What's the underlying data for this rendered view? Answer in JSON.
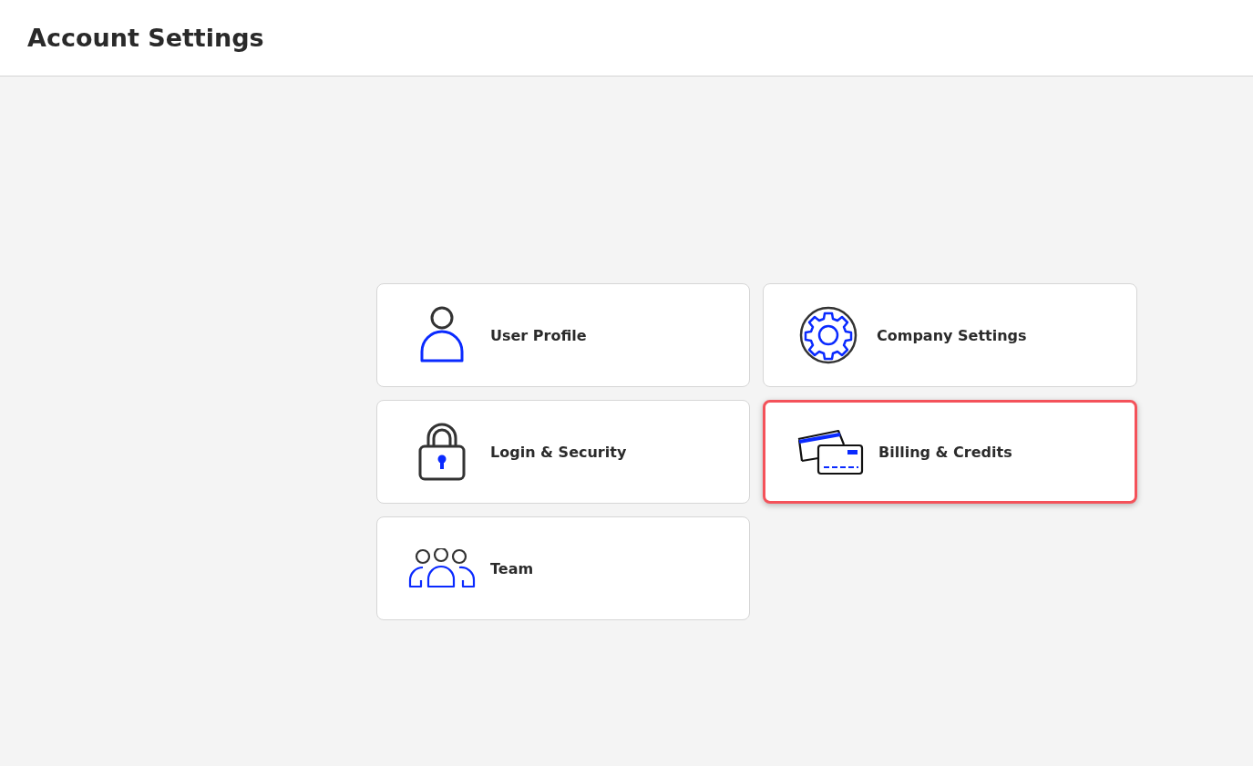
{
  "header": {
    "title": "Account Settings"
  },
  "cards": [
    {
      "kind": "user",
      "label": "User Profile",
      "highlighted": false
    },
    {
      "kind": "gear",
      "label": "Company Settings",
      "highlighted": false
    },
    {
      "kind": "lock",
      "label": "Login & Security",
      "highlighted": false
    },
    {
      "kind": "cards",
      "label": "Billing & Credits",
      "highlighted": true
    },
    {
      "kind": "team",
      "label": "Team",
      "highlighted": false
    }
  ]
}
